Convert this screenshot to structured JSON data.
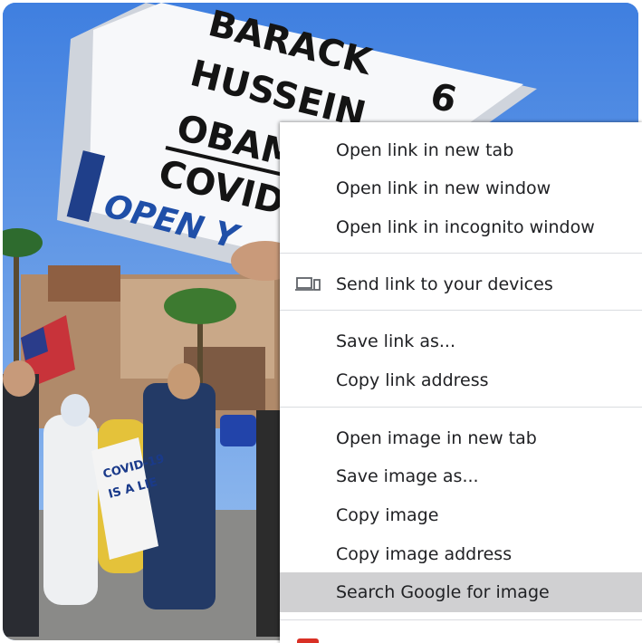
{
  "photo": {
    "sign_lines": [
      "BARACK",
      "HUSSEIN",
      "OBAMA",
      "COVID",
      "OPEN Y"
    ],
    "sign_number": "6",
    "small_sign_lines": [
      "COVID-19",
      "IS A LIE"
    ]
  },
  "menu": {
    "items": [
      {
        "label": "Open link in new tab"
      },
      {
        "label": "Open link in new window"
      },
      {
        "label": "Open link in incognito window"
      },
      {
        "label": "Send link to your devices",
        "icon": "devices-icon"
      },
      {
        "label": "Save link as..."
      },
      {
        "label": "Copy link address"
      },
      {
        "label": "Open image in new tab"
      },
      {
        "label": "Save image as..."
      },
      {
        "label": "Copy image"
      },
      {
        "label": "Copy image address"
      },
      {
        "label": "Search Google for image",
        "state": "hovered"
      }
    ]
  }
}
